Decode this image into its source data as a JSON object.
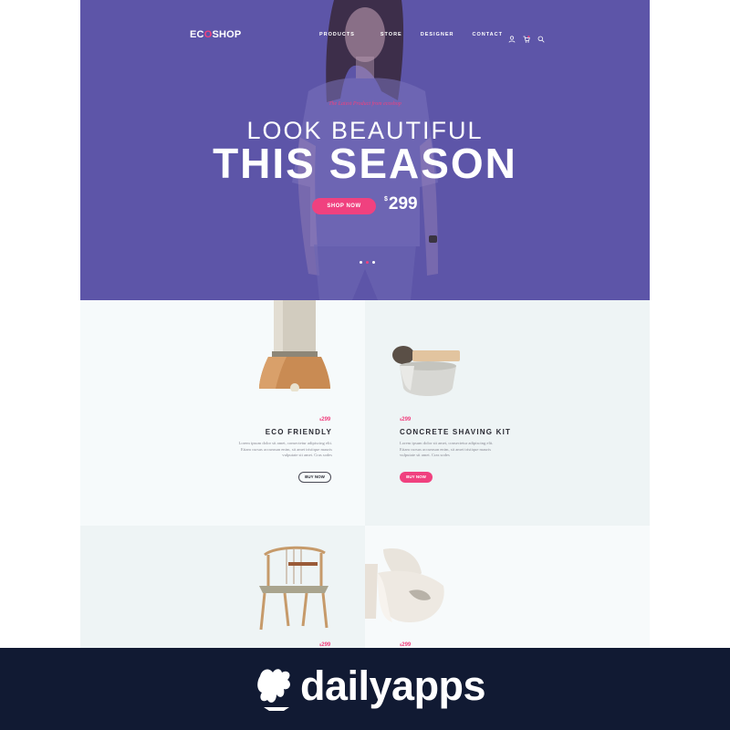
{
  "brand": {
    "logo_pre": "EC",
    "logo_o": "O",
    "logo_post": "SHOP"
  },
  "nav": {
    "items": [
      "PRODUCTS",
      "STORE",
      "DESIGNER",
      "CONTACT"
    ],
    "icons": [
      "user-icon",
      "cart-icon",
      "search-icon"
    ]
  },
  "hero": {
    "tagline": "The Latest Product from ecoshop",
    "headline_line1": "LOOK BEAUTIFUL",
    "headline_line2": "THIS SEASON",
    "cta_label": "SHOP NOW",
    "price_currency": "$",
    "price_value": "299",
    "slides_total": 3,
    "active_slide": 2,
    "background_color": "#5d55a8"
  },
  "products": [
    {
      "price_currency": "$",
      "price_value": "299",
      "title": "ECO FRIENDLY",
      "description": "Lorem ipsum dolor sit amet, consectetur adipiscing elit. Etiam cursus accumsan enim, sit amet tristique mauris vulputate sit amet. Cras sodes",
      "button_label": "BUY NOW",
      "button_style": "outline",
      "icon": "pendant-lamp-image"
    },
    {
      "price_currency": "$",
      "price_value": "299",
      "title": "CONCRETE SHAVING KIT",
      "description": "Lorem ipsum dolor sit amet, consectetur adipiscing elit. Etiam cursus accumsan enim, sit amet tristique mauris vulputate sit amet. Cras sodes",
      "button_label": "BUY NOW",
      "button_style": "filled",
      "icon": "shaving-kit-image"
    },
    {
      "price_currency": "$",
      "price_value": "299",
      "icon": "wooden-chair-image"
    },
    {
      "price_currency": "$",
      "price_value": "299",
      "icon": "ceramic-vases-image"
    }
  ],
  "watermark": {
    "name": "dailyapps",
    "background_color": "#111a33"
  },
  "colors": {
    "accent": "#f0417f",
    "text_dark": "#2a2a33"
  }
}
